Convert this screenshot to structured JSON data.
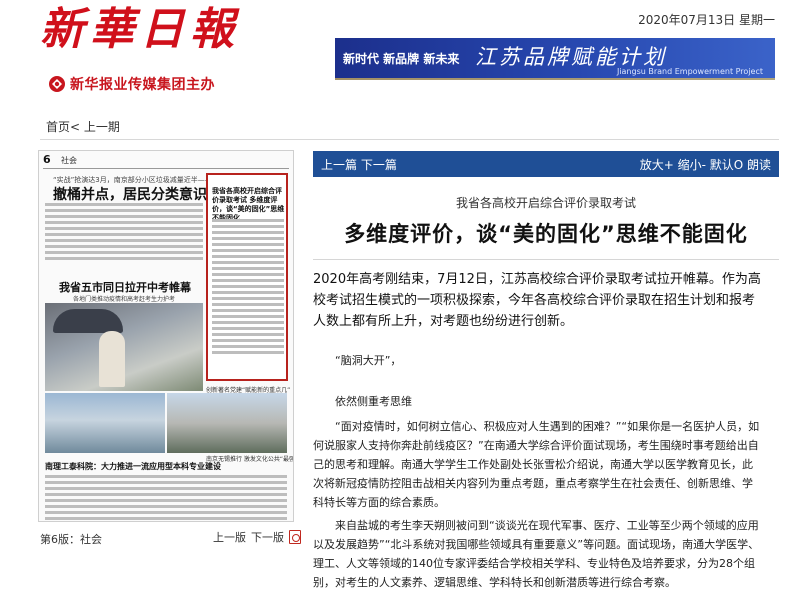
{
  "header": {
    "masthead": "新華日報",
    "publisher": "新华报业传媒集团主办",
    "date": "2020年07月13日 星期一",
    "banner": {
      "slogan": "新时代  新品牌  新未来",
      "title": "江苏品牌赋能计划",
      "subtitle": "Jiangsu Brand Empowerment Project"
    }
  },
  "nav": {
    "home": "首页",
    "sep": "<",
    "prev_issue": "上一期"
  },
  "thumbnail": {
    "page_no": "6",
    "section": "社会",
    "sub1": "“实战”抢演达3月，南京部分小区垃圾减量近半——",
    "headline1": "撤桶并点，居民分类意识强了",
    "box_headline": "我省各高校开启综合评价录取考试 多维度评价，谈“美的固化”思维不能固化",
    "headline2": "我省五市同日拉开中考帷幕",
    "headline2_sub": "各地门类推动疫情和高考赶考生力护考",
    "headline3": "创新著名党建“赋能新的重点几”",
    "headline4": "南理工泰科院：大力推进一流应用型本科专业建设",
    "small_note": "创新著名党建“赋能新的重点几”",
    "small_note2": "南京无锡推行 激发文化公共“最强”活动"
  },
  "page_label": "第6版：社会",
  "page_nav": {
    "prev": "上一版",
    "next": "下一版"
  },
  "article": {
    "toolbar_left": "上一篇  下一篇",
    "toolbar_right": "放大+  缩小-  默认O  朗读",
    "subtitle": "我省各高校开启综合评价录取考试",
    "title": "多维度评价，谈“美的固化”思维不能固化",
    "lead": "2020年高考刚结束，7月12日，江苏高校综合评价录取考试拉开帷幕。作为高校考试招生模式的一项积极探索，今年各高校综合评价录取在招生计划和报考人数上都有所上升，对考题也纷纷进行创新。",
    "p1": "“脑洞大开”，",
    "p2": "依然侧重考思维",
    "p3": "“面对疫情时，如何树立信心、积极应对人生遇到的困难？”“如果你是一名医护人员，如何说服家人支持你奔赴前线疫区？”在南通大学综合评价面试现场，考生围绕时事考题给出自己的思考和理解。南通大学学生工作处副处长张雪松介绍说，南通大学以医学教育见长，此次将新冠疫情防控阻击战相关内容列为重点考题，重点考察学生在社会责任、创新思维、学科特长等方面的综合素质。",
    "p4": "来自盐城的考生李天朔则被问到“谈谈光在现代军事、医疗、工业等至少两个领域的应用以及发展趋势”“北斗系统对我国哪些领域具有重要意义”等问题。面试现场，南通大学医学、理工、人文等领域的140位专家评委结合学校相关学科、专业特色及培养要求，分为28个组别，对考生的人文素养、逻辑思维、学科特长和创新潜质等进行综合考察。"
  },
  "colors": {
    "masthead_red": "#d0101b",
    "toolbar_blue": "#1f4f96",
    "banner_blue": "#2748b0",
    "highlight_box": "#b7221d"
  },
  "icons": {
    "publisher_logo": "xinhua-logo-icon",
    "pdf": "pdf-icon"
  }
}
